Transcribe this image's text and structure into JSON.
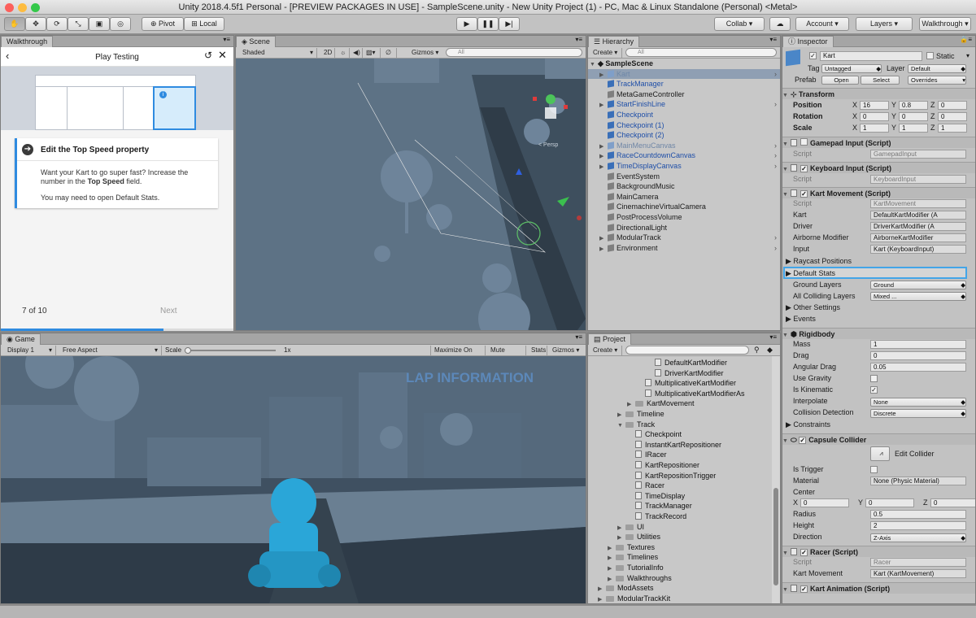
{
  "window_title": "Unity 2018.4.5f1 Personal - [PREVIEW PACKAGES IN USE] - SampleScene.unity - New Unity Project (1) - PC, Mac & Linux Standalone (Personal) <Metal>",
  "toolbar": {
    "pivot": "Pivot",
    "local": "Local",
    "collab": "Collab",
    "account": "Account",
    "layers": "Layers",
    "layout": "Walkthrough"
  },
  "walkthrough": {
    "tab": "Walkthrough",
    "title": "Play Testing",
    "step_title": "Edit the Top Speed property",
    "body_1": "Want your Kart to go super fast? Increase the number in the",
    "body_bold": "Top Speed",
    "body_2": "field.",
    "body_3": "You may need to open Default Stats.",
    "page": "7 of 10",
    "next": "Next",
    "progress": 0.7
  },
  "scene": {
    "tab": "Scene",
    "shading": "Shaded",
    "mode_2d": "2D",
    "gizmos": "Gizmos",
    "search": "All",
    "persp": "< Persp"
  },
  "game": {
    "tab": "Game",
    "display": "Display 1",
    "aspect": "Free Aspect",
    "scale_label": "Scale",
    "scale_value": "1x",
    "maximize": "Maximize On Play",
    "mute": "Mute Audio",
    "stats": "Stats",
    "gizmos": "Gizmos",
    "lap_info": "LAP INFORMATION"
  },
  "hierarchy": {
    "tab": "Hierarchy",
    "create": "Create",
    "search": "All",
    "scene": "SampleScene",
    "items": [
      {
        "label": "Kart",
        "indent": 1,
        "style": "selected",
        "arrow": true
      },
      {
        "label": "TrackManager",
        "indent": 1,
        "style": "blue",
        "arrow": false
      },
      {
        "label": "MetaGameController",
        "indent": 1,
        "style": "normal",
        "arrow": false
      },
      {
        "label": "StartFinishLine",
        "indent": 1,
        "style": "blue",
        "arrow": true
      },
      {
        "label": "Checkpoint",
        "indent": 1,
        "style": "blue",
        "arrow": false
      },
      {
        "label": "Checkpoint (1)",
        "indent": 1,
        "style": "blue",
        "arrow": false
      },
      {
        "label": "Checkpoint (2)",
        "indent": 1,
        "style": "blue",
        "arrow": false
      },
      {
        "label": "MainMenuCanvas",
        "indent": 1,
        "style": "grayblue",
        "arrow": true
      },
      {
        "label": "RaceCountdownCanvas",
        "indent": 1,
        "style": "blue",
        "arrow": true
      },
      {
        "label": "TimeDisplayCanvas",
        "indent": 1,
        "style": "blue",
        "arrow": true
      },
      {
        "label": "EventSystem",
        "indent": 1,
        "style": "normal",
        "arrow": false
      },
      {
        "label": "BackgroundMusic",
        "indent": 1,
        "style": "normal",
        "arrow": false
      },
      {
        "label": "MainCamera",
        "indent": 1,
        "style": "normal",
        "arrow": false
      },
      {
        "label": "CinemachineVirtualCamera",
        "indent": 1,
        "style": "normal",
        "arrow": false
      },
      {
        "label": "PostProcessVolume",
        "indent": 1,
        "style": "normal",
        "arrow": false
      },
      {
        "label": "DirectionalLight",
        "indent": 1,
        "style": "normal",
        "arrow": false
      },
      {
        "label": "ModularTrack",
        "indent": 1,
        "style": "normal",
        "arrow": true
      },
      {
        "label": "Environment",
        "indent": 1,
        "style": "normal",
        "arrow": true
      }
    ]
  },
  "project": {
    "tab": "Project",
    "create": "Create",
    "items": [
      {
        "label": "DefaultKartModifier",
        "type": "script",
        "indent": 6
      },
      {
        "label": "DriverKartModifier",
        "type": "script",
        "indent": 6
      },
      {
        "label": "MultiplicativeKartModifier",
        "type": "script",
        "indent": 5
      },
      {
        "label": "MultiplicativeKartModifierAs",
        "type": "script",
        "indent": 5
      },
      {
        "label": "KartMovement",
        "type": "folder",
        "indent": 4,
        "arrow": "▶"
      },
      {
        "label": "Timeline",
        "type": "folder",
        "indent": 3,
        "arrow": "▶"
      },
      {
        "label": "Track",
        "type": "folder",
        "indent": 3,
        "arrow": "▼"
      },
      {
        "label": "Checkpoint",
        "type": "script",
        "indent": 4
      },
      {
        "label": "InstantKartRepositioner",
        "type": "script",
        "indent": 4
      },
      {
        "label": "IRacer",
        "type": "script",
        "indent": 4
      },
      {
        "label": "KartRepositioner",
        "type": "script",
        "indent": 4
      },
      {
        "label": "KartRepositionTrigger",
        "type": "script",
        "indent": 4
      },
      {
        "label": "Racer",
        "type": "script",
        "indent": 4
      },
      {
        "label": "TimeDisplay",
        "type": "script",
        "indent": 4
      },
      {
        "label": "TrackManager",
        "type": "script",
        "indent": 4
      },
      {
        "label": "TrackRecord",
        "type": "script",
        "indent": 4
      },
      {
        "label": "UI",
        "type": "folder",
        "indent": 3,
        "arrow": "▶"
      },
      {
        "label": "Utilities",
        "type": "folder",
        "indent": 3,
        "arrow": "▶"
      },
      {
        "label": "Textures",
        "type": "folder",
        "indent": 2,
        "arrow": "▶"
      },
      {
        "label": "Timelines",
        "type": "folder",
        "indent": 2,
        "arrow": "▶"
      },
      {
        "label": "TutorialInfo",
        "type": "folder",
        "indent": 2,
        "arrow": "▶"
      },
      {
        "label": "Walkthroughs",
        "type": "folder",
        "indent": 2,
        "arrow": "▶"
      },
      {
        "label": "ModAssets",
        "type": "folder",
        "indent": 1,
        "arrow": "▶"
      },
      {
        "label": "ModularTrackKit",
        "type": "folder",
        "indent": 1,
        "arrow": "▶"
      }
    ]
  },
  "inspector": {
    "tab": "Inspector",
    "object_name": "Kart",
    "static": "Static",
    "tag_label": "Tag",
    "tag": "Untagged",
    "layer_label": "Layer",
    "layer": "Default",
    "prefab_label": "Prefab",
    "open": "Open",
    "select": "Select",
    "overrides": "Overrides",
    "transform": {
      "title": "Transform",
      "position_label": "Position",
      "position": [
        "16",
        "0.8",
        "0"
      ],
      "rotation_label": "Rotation",
      "rotation": [
        "0",
        "0",
        "0"
      ],
      "scale_label": "Scale",
      "scale": [
        "1",
        "1",
        "1"
      ]
    },
    "gamepad": {
      "title": "Gamepad Input (Script)",
      "script_label": "Script",
      "script": "GamepadInput"
    },
    "keyboard": {
      "title": "Keyboard Input (Script)",
      "script_label": "Script",
      "script": "KeyboardInput"
    },
    "kart_movement": {
      "title": "Kart Movement (Script)",
      "script_label": "Script",
      "script": "KartMovement",
      "kart_label": "Kart",
      "kart": "DefaultKartModifier (A",
      "driver_label": "Driver",
      "driver": "DriverKartModifier (A",
      "airborne_label": "Airborne Modifier",
      "airborne": "AirborneKartModifier",
      "input_label": "Input",
      "input": "Kart (KeyboardInput)",
      "raycast": "Raycast Positions",
      "default_stats": "Default Stats",
      "ground_layers_label": "Ground Layers",
      "ground_layers": "Ground",
      "colliding_label": "All Colliding Layers",
      "colliding": "Mixed ...",
      "other": "Other Settings",
      "events": "Events"
    },
    "rigidbody": {
      "title": "Rigidbody",
      "mass_label": "Mass",
      "mass": "1",
      "drag_label": "Drag",
      "drag": "0",
      "angular_label": "Angular Drag",
      "angular": "0.05",
      "gravity_label": "Use Gravity",
      "kinematic_label": "Is Kinematic",
      "kinematic_check": "✓",
      "interpolate_label": "Interpolate",
      "interpolate": "None",
      "collision_label": "Collision Detection",
      "collision": "Discrete",
      "constraints": "Constraints"
    },
    "capsule": {
      "title": "Capsule Collider",
      "edit": "Edit Collider",
      "trigger_label": "Is Trigger",
      "material_label": "Material",
      "material": "None (Physic Material)",
      "center_label": "Center",
      "center": [
        "0",
        "0",
        "0"
      ],
      "radius_label": "Radius",
      "radius": "0.5",
      "height_label": "Height",
      "height": "2",
      "direction_label": "Direction",
      "direction": "Z-Axis"
    },
    "racer": {
      "title": "Racer (Script)",
      "script_label": "Script",
      "script": "Racer",
      "km_label": "Kart Movement",
      "km": "Kart (KartMovement)"
    },
    "kart_anim": {
      "title": "Kart Animation (Script)"
    }
  },
  "axis_labels": {
    "x": "X",
    "y": "Y",
    "z": "Z"
  },
  "check": "✓"
}
